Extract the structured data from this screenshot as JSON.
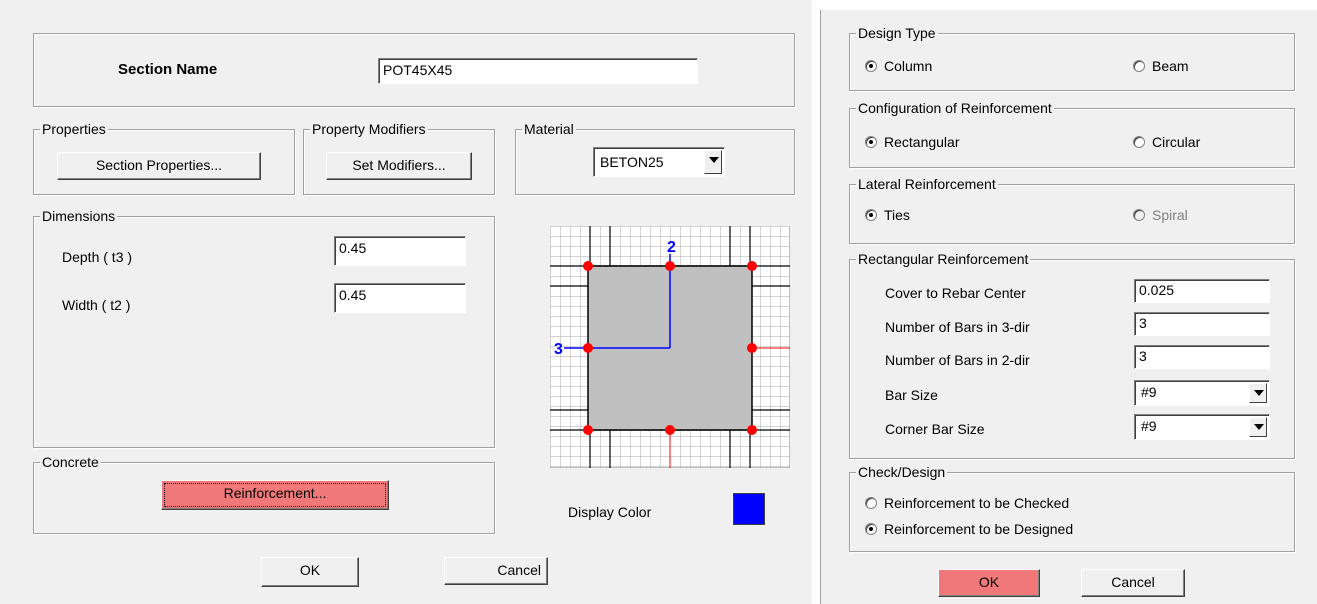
{
  "left": {
    "section_name_label": "Section Name",
    "section_name_value": "POT45X45",
    "properties": {
      "title": "Properties",
      "button": "Section Properties..."
    },
    "modifiers": {
      "title": "Property Modifiers",
      "button": "Set Modifiers..."
    },
    "material": {
      "title": "Material",
      "value": "BETON25"
    },
    "dimensions": {
      "title": "Dimensions",
      "depth_label": "Depth  ( t3 )",
      "depth_value": "0.45",
      "width_label": "Width  ( t2 )",
      "width_value": "0.45"
    },
    "section_preview": {
      "axis_vertical": "2",
      "axis_horizontal": "3"
    },
    "concrete": {
      "title": "Concrete",
      "button": "Reinforcement..."
    },
    "display_color": {
      "label": "Display Color",
      "color": "#0000ff"
    },
    "ok": "OK",
    "cancel": "Cancel"
  },
  "right": {
    "design_type": {
      "title": "Design Type",
      "opt1": "Column",
      "opt2": "Beam",
      "selected": "Column"
    },
    "configuration": {
      "title": "Configuration of Reinforcement",
      "opt1": "Rectangular",
      "opt2": "Circular",
      "selected": "Rectangular"
    },
    "lateral": {
      "title": "Lateral Reinforcement",
      "opt1": "Ties",
      "opt2": "Spiral",
      "selected": "Ties"
    },
    "rectangular": {
      "title": "Rectangular Reinforcement",
      "cover_label": "Cover to Rebar Center",
      "cover_value": "0.025",
      "bars3_label": "Number of Bars in 3-dir",
      "bars3_value": "3",
      "bars2_label": "Number of Bars in 2-dir",
      "bars2_value": "3",
      "barsize_label": "Bar Size",
      "barsize_value": "#9",
      "corner_label": "Corner Bar Size",
      "corner_value": "#9"
    },
    "check_design": {
      "title": "Check/Design",
      "opt1": "Reinforcement to be Checked",
      "opt2": "Reinforcement to be Designed",
      "selected": "Reinforcement to be Designed"
    },
    "ok": "OK",
    "cancel": "Cancel"
  },
  "colors": {
    "accent_button": "#f07878",
    "dialog_bg": "#f0f0f0",
    "rebar": "#ff0000",
    "axis": "#0000ff"
  }
}
